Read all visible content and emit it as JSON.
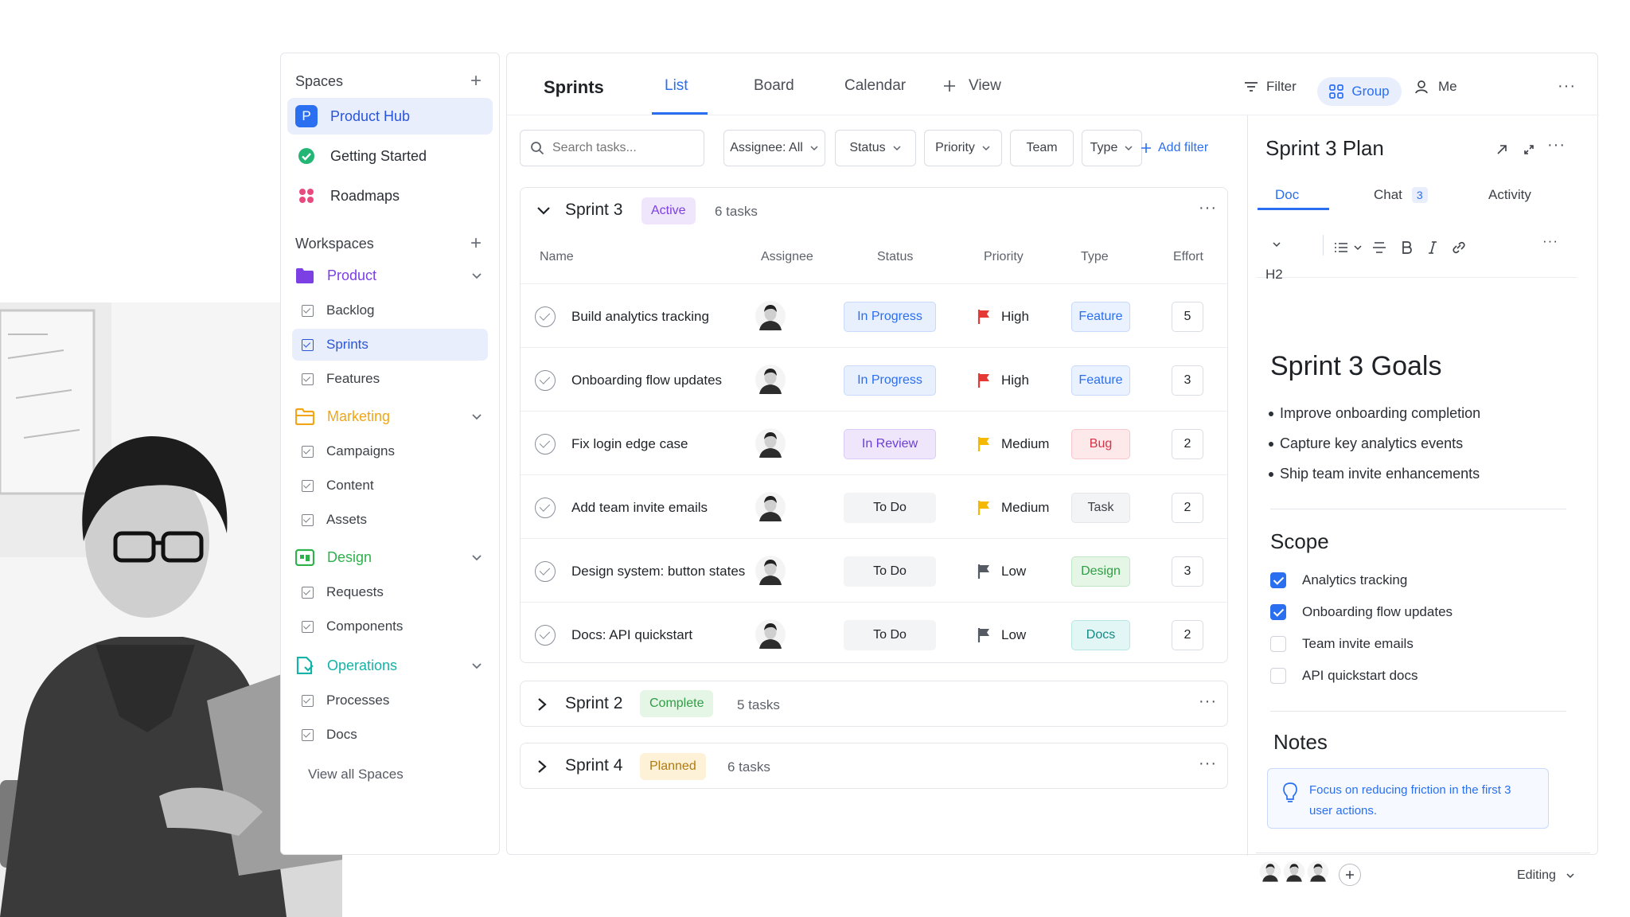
{
  "sidebar": {
    "spaces_label": "Spaces",
    "spaces": [
      {
        "label": "Product Hub",
        "icon_letter": "P",
        "icon": "product-hub-icon",
        "color": "#2a6ff0",
        "active": true
      },
      {
        "label": "Getting Started",
        "icon": "check-circle-icon",
        "color": "#22b573",
        "active": false
      },
      {
        "label": "Roadmaps",
        "icon": "grid-dots-icon",
        "color": "#e84a7f",
        "active": false
      }
    ],
    "workspaces_label": "Workspaces",
    "workspaces": [
      {
        "label": "Product",
        "color": "#7b3fe4",
        "children": [
          "Backlog",
          "Sprints",
          "Features"
        ]
      },
      {
        "label": "Marketing",
        "color": "#f2a516",
        "children": [
          "Campaigns",
          "Content",
          "Assets"
        ]
      },
      {
        "label": "Design",
        "color": "#2fb24c",
        "children": [
          "Requests",
          "Components"
        ]
      },
      {
        "label": "Operations",
        "color": "#14b3a7",
        "children": [
          "Processes",
          "Docs"
        ]
      }
    ],
    "active_child": "Sprints",
    "view_all": "View all Spaces"
  },
  "tabs": {
    "title": "Sprints",
    "items": [
      "List",
      "Board",
      "Calendar"
    ],
    "active": "List",
    "add_view": "View",
    "filter": "Filter",
    "group": "Group",
    "me": "Me"
  },
  "filters": {
    "search_placeholder": "Search tasks...",
    "assignee": "Assignee: All",
    "status": "Status",
    "priority": "Priority",
    "team": "Team",
    "type": "Type",
    "add_filter": "Add filter"
  },
  "sprint3": {
    "title": "Sprint 3",
    "status": "Active",
    "count": "6 tasks",
    "columns": [
      "Name",
      "Assignee",
      "Status",
      "Priority",
      "Type",
      "Effort"
    ],
    "rows": [
      {
        "name": "Build analytics tracking",
        "status": "In Progress",
        "priority": "High",
        "type": "Feature",
        "effort": "5"
      },
      {
        "name": "Onboarding flow updates",
        "status": "In Progress",
        "priority": "High",
        "type": "Feature",
        "effort": "3"
      },
      {
        "name": "Fix login edge case",
        "status": "In Review",
        "priority": "Medium",
        "type": "Bug",
        "effort": "2"
      },
      {
        "name": "Add team invite emails",
        "status": "To Do",
        "priority": "Medium",
        "type": "Task",
        "effort": "2"
      },
      {
        "name": "Design system: button states",
        "status": "To Do",
        "priority": "Low",
        "type": "Design",
        "effort": "3"
      },
      {
        "name": "Docs: API quickstart",
        "status": "To Do",
        "priority": "Low",
        "type": "Docs",
        "effort": "2"
      }
    ]
  },
  "sprint2": {
    "title": "Sprint 2",
    "status": "Complete",
    "count": "5 tasks"
  },
  "sprint4": {
    "title": "Sprint 4",
    "status": "Planned",
    "count": "6 tasks"
  },
  "panel": {
    "title": "Sprint 3 Plan",
    "tabs": {
      "doc": "Doc",
      "chat": "Chat",
      "chat_count": "3",
      "activity": "Activity"
    },
    "heading_level": "H2",
    "goals_title": "Sprint 3 Goals",
    "goals": [
      "Improve onboarding completion",
      "Capture key analytics events",
      "Ship team invite enhancements"
    ],
    "scope_title": "Scope",
    "scope": [
      {
        "label": "Analytics tracking",
        "checked": true
      },
      {
        "label": "Onboarding flow updates",
        "checked": true
      },
      {
        "label": "Team invite emails",
        "checked": false
      },
      {
        "label": "API quickstart docs",
        "checked": false
      }
    ],
    "notes_title": "Notes",
    "note": "Focus on reducing friction in the first 3 user actions.",
    "mode": "Editing"
  },
  "colors": {
    "accent": "#2a6ff0",
    "high": "#e53935",
    "medium": "#f5b800",
    "low": "#555a63"
  }
}
